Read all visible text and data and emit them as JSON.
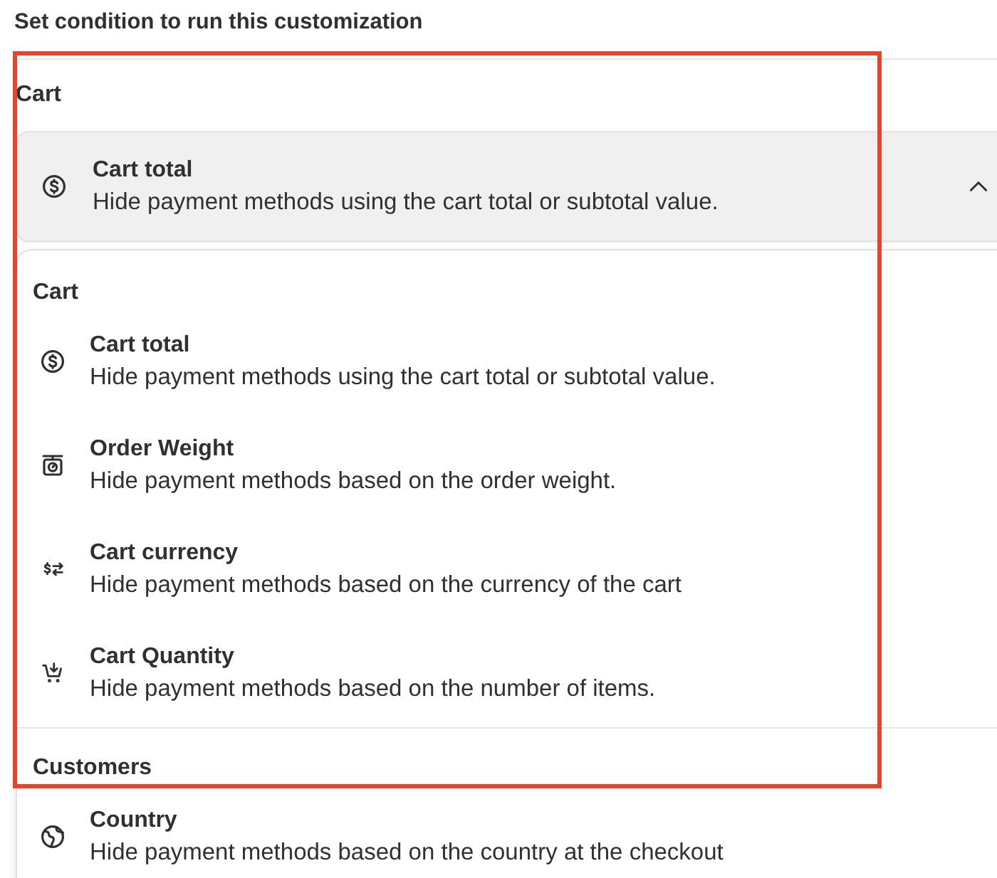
{
  "heading": "Set condition to run this customization",
  "condition_field": {
    "label": "Cart",
    "kind": "total",
    "title": "Cart total",
    "description": "Hide payment methods using the cart total or subtotal value.",
    "expanded": true
  },
  "dropdown": {
    "groups": [
      {
        "title": "Cart",
        "options": [
          {
            "kind": "total",
            "title": "Cart total",
            "description": "Hide payment methods using the cart total or subtotal value."
          },
          {
            "kind": "weight",
            "title": "Order Weight",
            "description": "Hide payment methods based on the order weight."
          },
          {
            "kind": "currency",
            "title": "Cart currency",
            "description": "Hide payment methods based on the currency of the cart"
          },
          {
            "kind": "quantity",
            "title": "Cart Quantity",
            "description": "Hide payment methods based on the number of items."
          }
        ]
      },
      {
        "title": "Customers",
        "options": [
          {
            "kind": "country",
            "title": "Country",
            "description": "Hide payment methods based on the country at the checkout"
          }
        ]
      }
    ]
  },
  "annotation": {
    "kind": "frame"
  }
}
